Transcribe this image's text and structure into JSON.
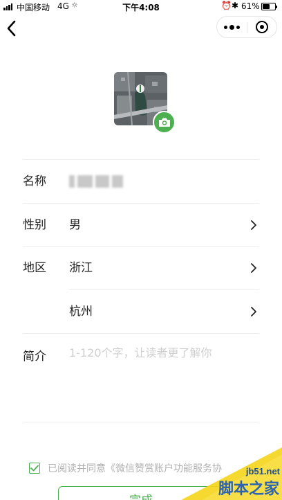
{
  "status_bar": {
    "carrier": "中国移动",
    "network": "4G",
    "activity": "☼",
    "time": "下午4:08",
    "alarm": "⏰",
    "bluetooth": "✱",
    "battery_text": "61%",
    "battery_level": 0.61
  },
  "nav": {
    "back_icon": "chevron-left-icon",
    "more_icon": "more-dots-icon",
    "close_icon": "target-close-icon"
  },
  "avatar": {
    "image": "aerial-map-thumbnail",
    "camera_icon": "camera-icon"
  },
  "form": {
    "name_label": "名称",
    "name_value": "",
    "gender_label": "性别",
    "gender_value": "男",
    "region_label": "地区",
    "region_province": "浙江",
    "region_city": "杭州",
    "intro_label": "简介",
    "intro_placeholder": "1-120个字，让读者更了解你"
  },
  "agreement": {
    "checked": true,
    "text": "已阅读并同意《微信赞赏账户功能服务协"
  },
  "submit": {
    "label": "完成"
  },
  "watermark": {
    "site": "jb51.net",
    "brand": "脚本之家"
  },
  "colors": {
    "accent": "#4caf50",
    "divider": "#ececec",
    "placeholder": "#cfcfcf"
  }
}
